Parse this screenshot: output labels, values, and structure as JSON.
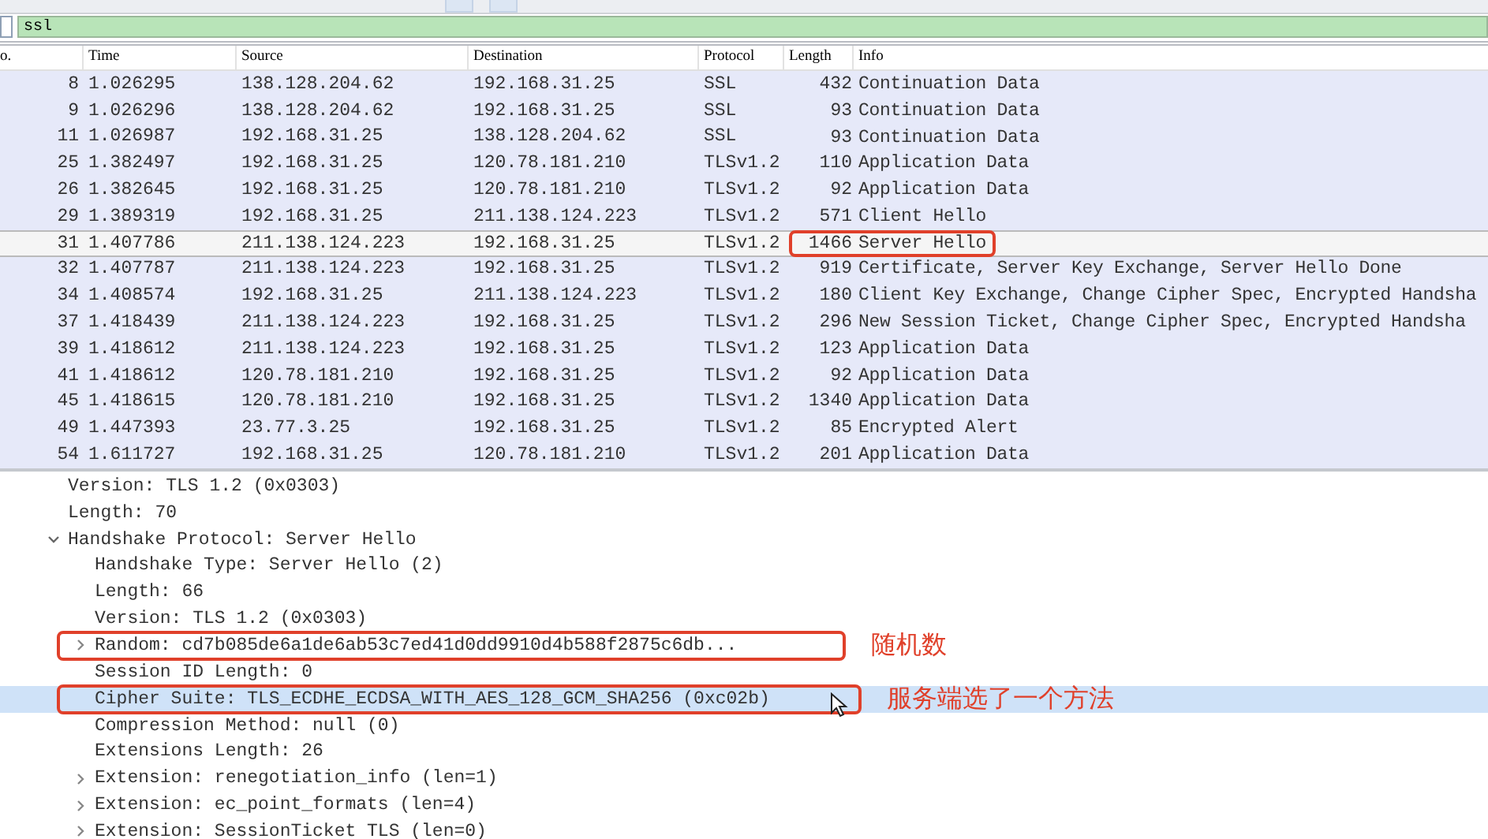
{
  "filter": {
    "value": "ssl"
  },
  "columns": [
    "o.",
    "Time",
    "Source",
    "Destination",
    "Protocol",
    "Length",
    "Info"
  ],
  "packets": [
    {
      "no": "8",
      "time": "1.026295",
      "source": "138.128.204.62",
      "destination": "192.168.31.25",
      "protocol": "SSL",
      "length": "432",
      "info": "Continuation Data",
      "selected": false,
      "annotated": false
    },
    {
      "no": "9",
      "time": "1.026296",
      "source": "138.128.204.62",
      "destination": "192.168.31.25",
      "protocol": "SSL",
      "length": "93",
      "info": "Continuation Data",
      "selected": false,
      "annotated": false
    },
    {
      "no": "11",
      "time": "1.026987",
      "source": "192.168.31.25",
      "destination": "138.128.204.62",
      "protocol": "SSL",
      "length": "93",
      "info": "Continuation Data",
      "selected": false,
      "annotated": false
    },
    {
      "no": "25",
      "time": "1.382497",
      "source": "192.168.31.25",
      "destination": "120.78.181.210",
      "protocol": "TLSv1.2",
      "length": "110",
      "info": "Application Data",
      "selected": false,
      "annotated": false
    },
    {
      "no": "26",
      "time": "1.382645",
      "source": "192.168.31.25",
      "destination": "120.78.181.210",
      "protocol": "TLSv1.2",
      "length": "92",
      "info": "Application Data",
      "selected": false,
      "annotated": false
    },
    {
      "no": "29",
      "time": "1.389319",
      "source": "192.168.31.25",
      "destination": "211.138.124.223",
      "protocol": "TLSv1.2",
      "length": "571",
      "info": "Client Hello",
      "selected": false,
      "annotated": false
    },
    {
      "no": "31",
      "time": "1.407786",
      "source": "211.138.124.223",
      "destination": "192.168.31.25",
      "protocol": "TLSv1.2",
      "length": "1466",
      "info": "Server Hello",
      "selected": true,
      "annotated": true
    },
    {
      "no": "32",
      "time": "1.407787",
      "source": "211.138.124.223",
      "destination": "192.168.31.25",
      "protocol": "TLSv1.2",
      "length": "919",
      "info": "Certificate, Server Key Exchange, Server Hello Done",
      "selected": false,
      "annotated": false
    },
    {
      "no": "34",
      "time": "1.408574",
      "source": "192.168.31.25",
      "destination": "211.138.124.223",
      "protocol": "TLSv1.2",
      "length": "180",
      "info": "Client Key Exchange, Change Cipher Spec, Encrypted Handsha",
      "selected": false,
      "annotated": false
    },
    {
      "no": "37",
      "time": "1.418439",
      "source": "211.138.124.223",
      "destination": "192.168.31.25",
      "protocol": "TLSv1.2",
      "length": "296",
      "info": "New Session Ticket, Change Cipher Spec, Encrypted Handsha",
      "selected": false,
      "annotated": false
    },
    {
      "no": "39",
      "time": "1.418612",
      "source": "211.138.124.223",
      "destination": "192.168.31.25",
      "protocol": "TLSv1.2",
      "length": "123",
      "info": "Application Data",
      "selected": false,
      "annotated": false
    },
    {
      "no": "41",
      "time": "1.418612",
      "source": "120.78.181.210",
      "destination": "192.168.31.25",
      "protocol": "TLSv1.2",
      "length": "92",
      "info": "Application Data",
      "selected": false,
      "annotated": false
    },
    {
      "no": "45",
      "time": "1.418615",
      "source": "120.78.181.210",
      "destination": "192.168.31.25",
      "protocol": "TLSv1.2",
      "length": "1340",
      "info": "Application Data",
      "selected": false,
      "annotated": false
    },
    {
      "no": "49",
      "time": "1.447393",
      "source": "23.77.3.25",
      "destination": "192.168.31.25",
      "protocol": "TLSv1.2",
      "length": "85",
      "info": "Encrypted Alert",
      "selected": false,
      "annotated": false
    },
    {
      "no": "54",
      "time": "1.611727",
      "source": "192.168.31.25",
      "destination": "120.78.181.210",
      "protocol": "TLSv1.2",
      "length": "201",
      "info": "Application Data",
      "selected": false,
      "annotated": false
    }
  ],
  "details": [
    {
      "text": "Version: TLS 1.2 (0x0303)",
      "selected": false
    },
    {
      "text": "Length: 70",
      "selected": false
    },
    {
      "text": "Handshake Protocol: Server Hello",
      "expanded": true,
      "selected": false,
      "children": [
        {
          "text": "Handshake Type: Server Hello (2)",
          "selected": false
        },
        {
          "text": "Length: 66",
          "selected": false
        },
        {
          "text": "Version: TLS 1.2 (0x0303)",
          "selected": false
        },
        {
          "text": "Random: cd7b085de6a1de6ab53c7ed41d0dd9910d4b588f2875c6db...",
          "expanded": false,
          "selected": false,
          "note": "随机数"
        },
        {
          "text": "Session ID Length: 0",
          "selected": false
        },
        {
          "text": "Cipher Suite: TLS_ECDHE_ECDSA_WITH_AES_128_GCM_SHA256 (0xc02b)",
          "selected": true,
          "note": "服务端选了一个方法"
        },
        {
          "text": "Compression Method: null (0)",
          "selected": false
        },
        {
          "text": "Extensions Length: 26",
          "selected": false
        },
        {
          "text": "Extension: renegotiation_info (len=1)",
          "expanded": false,
          "selected": false
        },
        {
          "text": "Extension: ec_point_formats (len=4)",
          "expanded": false,
          "selected": false
        },
        {
          "text": "Extension: SessionTicket TLS (len=0)",
          "expanded": false,
          "selected": false
        }
      ]
    }
  ]
}
